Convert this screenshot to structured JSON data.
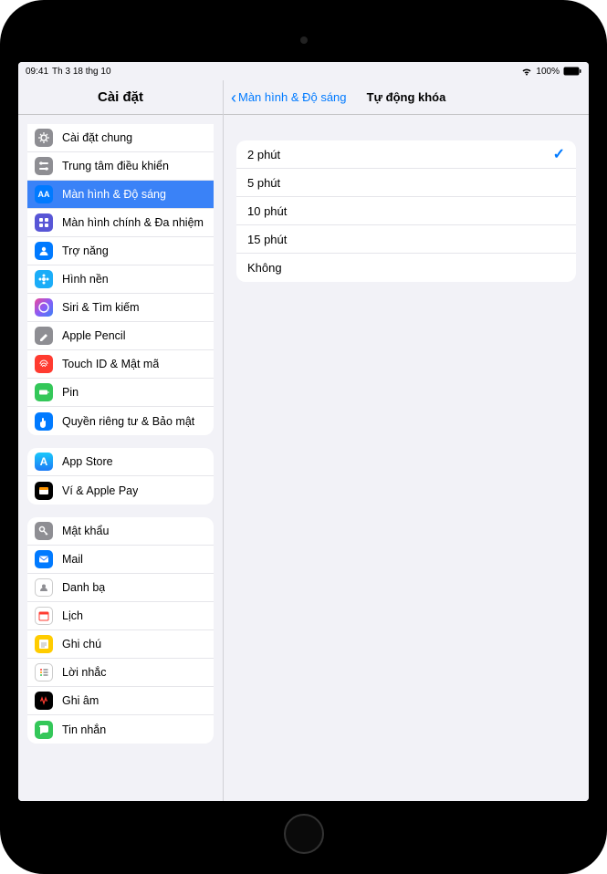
{
  "status": {
    "time": "09:41",
    "date": "Th 3 18 thg 10",
    "battery": "100%"
  },
  "sidebar": {
    "title": "Cài đặt",
    "groups": [
      {
        "items": [
          {
            "id": "general",
            "label": "Cài đặt chung",
            "icon": "gear",
            "bg": "bg-gray"
          },
          {
            "id": "control-center",
            "label": "Trung tâm điều khiển",
            "icon": "switches",
            "bg": "bg-gray2"
          },
          {
            "id": "display",
            "label": "Màn hình & Độ sáng",
            "icon": "AA",
            "bg": "bg-blue",
            "selected": true
          },
          {
            "id": "home-screen",
            "label": "Màn hình chính & Đa nhiệm",
            "icon": "grid",
            "bg": "bg-indigo"
          },
          {
            "id": "accessibility",
            "label": "Trợ năng",
            "icon": "person",
            "bg": "bg-blue"
          },
          {
            "id": "wallpaper",
            "label": "Hình nền",
            "icon": "flower",
            "bg": "bg-cyan"
          },
          {
            "id": "siri",
            "label": "Siri & Tìm kiếm",
            "icon": "siri",
            "bg": "bg-grad"
          },
          {
            "id": "pencil",
            "label": "Apple Pencil",
            "icon": "pencil",
            "bg": "bg-gray"
          },
          {
            "id": "touchid",
            "label": "Touch ID & Mật mã",
            "icon": "fingerprint",
            "bg": "bg-red"
          },
          {
            "id": "battery",
            "label": "Pin",
            "icon": "battery",
            "bg": "bg-green"
          },
          {
            "id": "privacy",
            "label": "Quyền riêng tư & Bảo mật",
            "icon": "hand",
            "bg": "bg-privacy"
          }
        ]
      },
      {
        "items": [
          {
            "id": "appstore",
            "label": "App Store",
            "icon": "A",
            "bg": "bg-appstore"
          },
          {
            "id": "wallet",
            "label": "Ví & Apple Pay",
            "icon": "wallet",
            "bg": "bg-black"
          }
        ]
      },
      {
        "items": [
          {
            "id": "passwords",
            "label": "Mật khẩu",
            "icon": "key",
            "bg": "bg-gray"
          },
          {
            "id": "mail",
            "label": "Mail",
            "icon": "mail",
            "bg": "bg-blue"
          },
          {
            "id": "contacts",
            "label": "Danh bạ",
            "icon": "contacts",
            "bg": "bg-white"
          },
          {
            "id": "calendar",
            "label": "Lịch",
            "icon": "cal",
            "bg": "bg-white"
          },
          {
            "id": "notes",
            "label": "Ghi chú",
            "icon": "notes",
            "bg": "bg-yellow"
          },
          {
            "id": "reminders",
            "label": "Lời nhắc",
            "icon": "reminders",
            "bg": "bg-white"
          },
          {
            "id": "voicememos",
            "label": "Ghi âm",
            "icon": "wave",
            "bg": "bg-black"
          },
          {
            "id": "messages",
            "label": "Tin nhắn",
            "icon": "bubble",
            "bg": "bg-green"
          }
        ]
      }
    ]
  },
  "detail": {
    "back_label": "Màn hình & Độ sáng",
    "title": "Tự động khóa",
    "options": [
      {
        "label": "2 phút",
        "selected": true
      },
      {
        "label": "5 phút",
        "selected": false
      },
      {
        "label": "10 phút",
        "selected": false
      },
      {
        "label": "15 phút",
        "selected": false
      },
      {
        "label": "Không",
        "selected": false
      }
    ]
  }
}
